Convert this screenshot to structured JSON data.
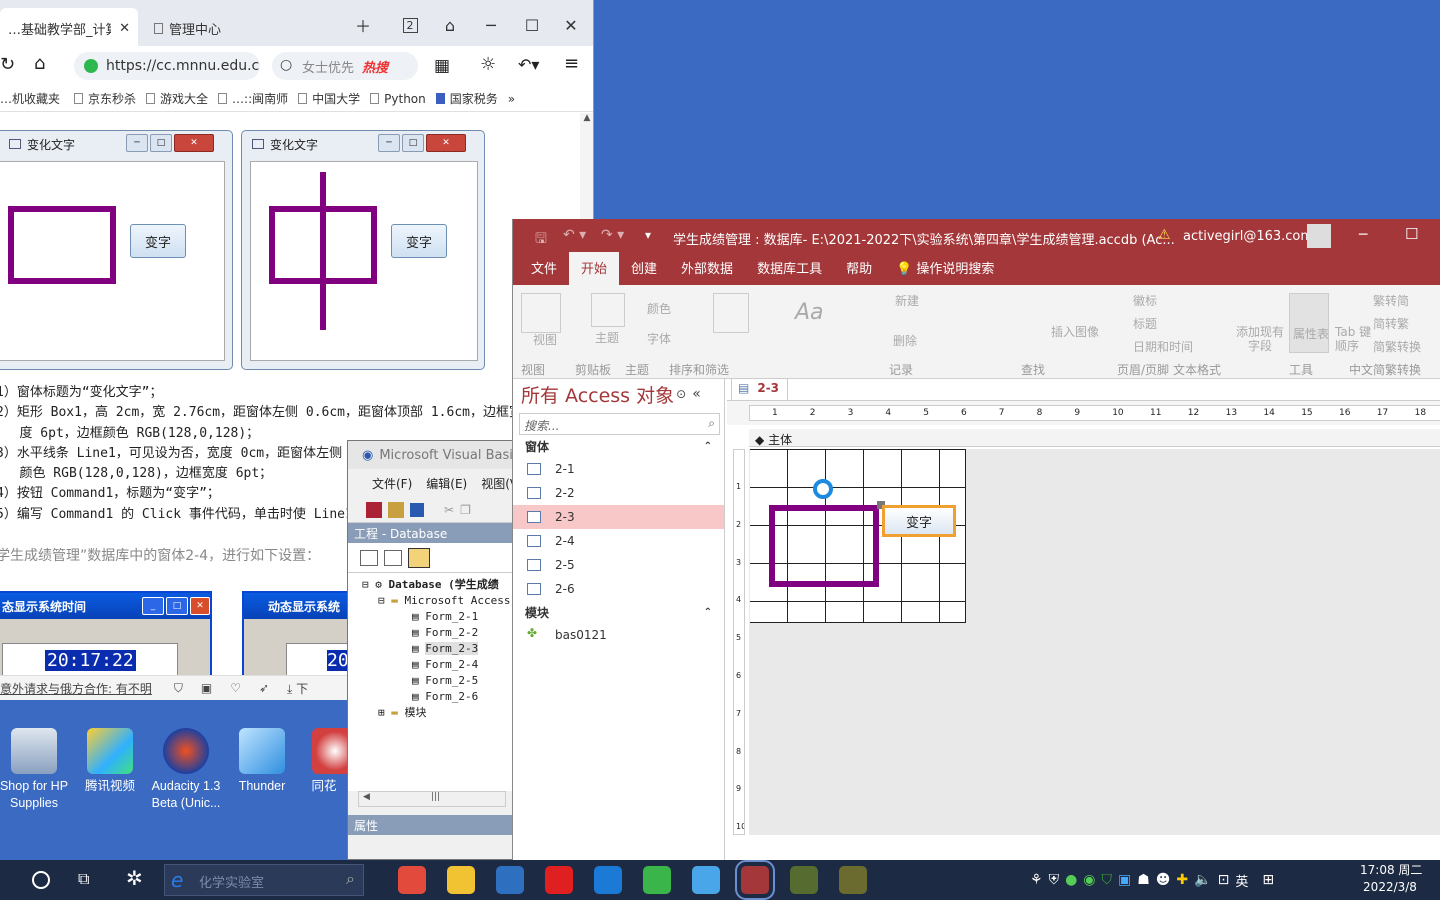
{
  "browser": {
    "tabs": [
      "…基础教学部_计算机应",
      "管理中心"
    ],
    "tab_counter": "2",
    "url": "https://cc.mnnu.edu.c",
    "search_placeholder": "女士优先",
    "hot_label": "热搜",
    "bookmarks": [
      "…机收藏夹",
      "京东秒杀",
      "游戏大全",
      "…::闽南师",
      "中国大学",
      "Python",
      "国家税务"
    ],
    "bookmark_more": "»",
    "form_window_title_1": "变化文字",
    "form_window_title_2": "变化文字",
    "form_button_1": "变字",
    "form_button_2": "变字",
    "doc_lines": [
      "1）窗体标题为“变化文字”；",
      "2）矩形 Box1，高 2cm，宽 2.76cm，距窗体左侧 0.6cm，距窗体顶部 1.6cm，边框宽",
      "   度 6pt，边框颜色 RGB(128,0,128)；",
      "3）水平线条 Line1，可见设为否，宽度 0cm，距窗体左侧",
      "   颜色 RGB(128,0,128)，边框宽度 6pt；",
      "4）按钮 Command1，标题为“变字”；",
      "5）编写 Command1 的 Click 事件代码，单击时使 Line1 可"
    ],
    "doc_task": "学生成绩管理”数据库中的窗体2-4，进行如下设置：",
    "time_window_title_1": "态显示系统时间",
    "time_window_title_2": "动态显示系统",
    "time_value": "20:17:22",
    "time_value_2": "20",
    "status_text": "意外请求与俄方合作: 有不明",
    "status_right": "下"
  },
  "desktop_icons": [
    {
      "label": "Shop for HP Supplies",
      "color": "#3d88d8"
    },
    {
      "label": "腾讯视频",
      "color": "#2fa6f0"
    },
    {
      "label": "Audacity 1.3 Beta (Unic...",
      "color": "#f0a020"
    },
    {
      "label": "Thunder",
      "color": "#3aa0e0"
    },
    {
      "label": "同花",
      "color": "#d24040"
    }
  ],
  "vbe": {
    "title": "Microsoft Visual Basic",
    "menu": [
      "文件(F)",
      "编辑(E)",
      "视图(V)"
    ],
    "project_label": "工程 - Database",
    "tree_root": "Database (学生成绩",
    "tree_folder": "Microsoft Access",
    "forms": [
      "Form_2-1",
      "Form_2-2",
      "Form_2-3",
      "Form_2-4",
      "Form_2-5",
      "Form_2-6"
    ],
    "modules": "模块",
    "properties_label": "属性"
  },
  "access": {
    "title": "学生成绩管理 : 数据库- E:\\2021-2022下\\实验系统\\第四章\\学生成绩管理.accdb (Ac...",
    "user": "activegirl@163.com",
    "menu": [
      "文件",
      "开始",
      "创建",
      "外部数据",
      "数据库工具",
      "帮助",
      "操作说明搜索"
    ],
    "active_menu": "开始",
    "ribbon_groups": [
      "视图",
      "剪贴板",
      "主题",
      "排序和筛选",
      "记录",
      "查找",
      "页眉/页脚",
      "文本格式",
      "工具",
      "中文简繁转换"
    ],
    "ribbon_buttons": [
      "视图",
      "主题",
      "颜色",
      "字体",
      "插入图像",
      "标题",
      "日期和时间",
      "添加现有字段",
      "属性表",
      "Tab 键顺序",
      "繁转简",
      "简转繁",
      "简繁转换",
      "新建",
      "删除",
      "徽标"
    ],
    "nav_title": "所有 Access 对象",
    "nav_search": "搜索...",
    "group_forms": "窗体",
    "forms": [
      "2-1",
      "2-2",
      "2-3",
      "2-4",
      "2-5",
      "2-6"
    ],
    "selected_form": "2-3",
    "group_modules": "模块",
    "modules": [
      "bas0121"
    ],
    "doc_tab": "2-3",
    "section_label": "主体",
    "design_button": "变字",
    "ruler_numbers": [
      "1",
      "2",
      "3",
      "4",
      "5",
      "6",
      "7",
      "8",
      "9",
      "10",
      "11",
      "12",
      "13",
      "14",
      "15",
      "16",
      "17",
      "18"
    ],
    "vruler_numbers": [
      "1",
      "2",
      "3",
      "4",
      "5",
      "6",
      "7",
      "8",
      "9",
      "10"
    ]
  },
  "taskbar": {
    "search_placeholder": "化学实验室",
    "clock_time": "17:08 周二",
    "clock_date": "2022/3/8",
    "ime": "英",
    "apps": [
      {
        "name": "chrome",
        "color": "#e24a3b"
      },
      {
        "name": "explorer",
        "color": "#f1c232"
      },
      {
        "name": "calculator",
        "color": "#2f6fbf"
      },
      {
        "name": "youdao",
        "color": "#e02020"
      },
      {
        "name": "kugou",
        "color": "#1b7ad6"
      },
      {
        "name": "360",
        "color": "#39b54a"
      },
      {
        "name": "qq-music",
        "color": "#49a6e9"
      },
      {
        "name": "access",
        "color": "#a4373a"
      },
      {
        "name": "vba",
        "color": "#556b2f"
      },
      {
        "name": "vba-2",
        "color": "#6b6b2f"
      }
    ]
  },
  "colors": {
    "access_red": "#a4373a",
    "purple": "#800080",
    "desktop": "#3a6ac2"
  }
}
